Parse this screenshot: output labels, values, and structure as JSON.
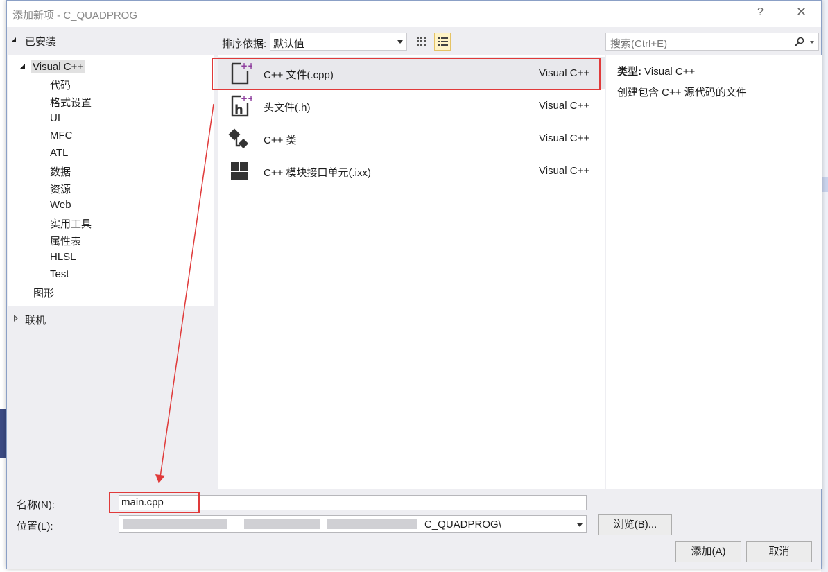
{
  "dialog": {
    "title": "添加新项 - C_QUADPROG",
    "help_label": "?",
    "close_label": "✕"
  },
  "tree": {
    "installed_label": "已安装",
    "visual_cpp_label": "Visual C++",
    "children": [
      "代码",
      "格式设置",
      "UI",
      "MFC",
      "ATL",
      "数据",
      "资源",
      "Web",
      "实用工具",
      "属性表",
      "HLSL",
      "Test"
    ],
    "graphics_label": "图形",
    "online_label": "联机"
  },
  "toolbar": {
    "sort_label": "排序依据:",
    "sort_value": "默认值",
    "search_placeholder": "搜索(Ctrl+E)"
  },
  "templates": [
    {
      "name": "C++ 文件(.cpp)",
      "lang": "Visual C++",
      "icon": "cpp-file-icon"
    },
    {
      "name": "头文件(.h)",
      "lang": "Visual C++",
      "icon": "header-file-icon"
    },
    {
      "name": "C++ 类",
      "lang": "Visual C++",
      "icon": "cpp-class-icon"
    },
    {
      "name": "C++ 模块接口单元(.ixx)",
      "lang": "Visual C++",
      "icon": "module-unit-icon"
    }
  ],
  "description": {
    "type_label": "类型:",
    "type_value": "Visual C++",
    "text": "创建包含 C++ 源代码的文件"
  },
  "form": {
    "name_label": "名称(N):",
    "name_value": "main.cpp",
    "location_label": "位置(L):",
    "location_visible_suffix": "C_QUADPROG\\",
    "browse_label": "浏览(B)...",
    "add_label": "添加(A)",
    "cancel_label": "取消"
  },
  "colors": {
    "annotation_red": "#e03a3a",
    "selection_bg": "#e8e8ec",
    "dialog_bg": "#eeeef2",
    "icon_purple": "#8e3e9e"
  }
}
